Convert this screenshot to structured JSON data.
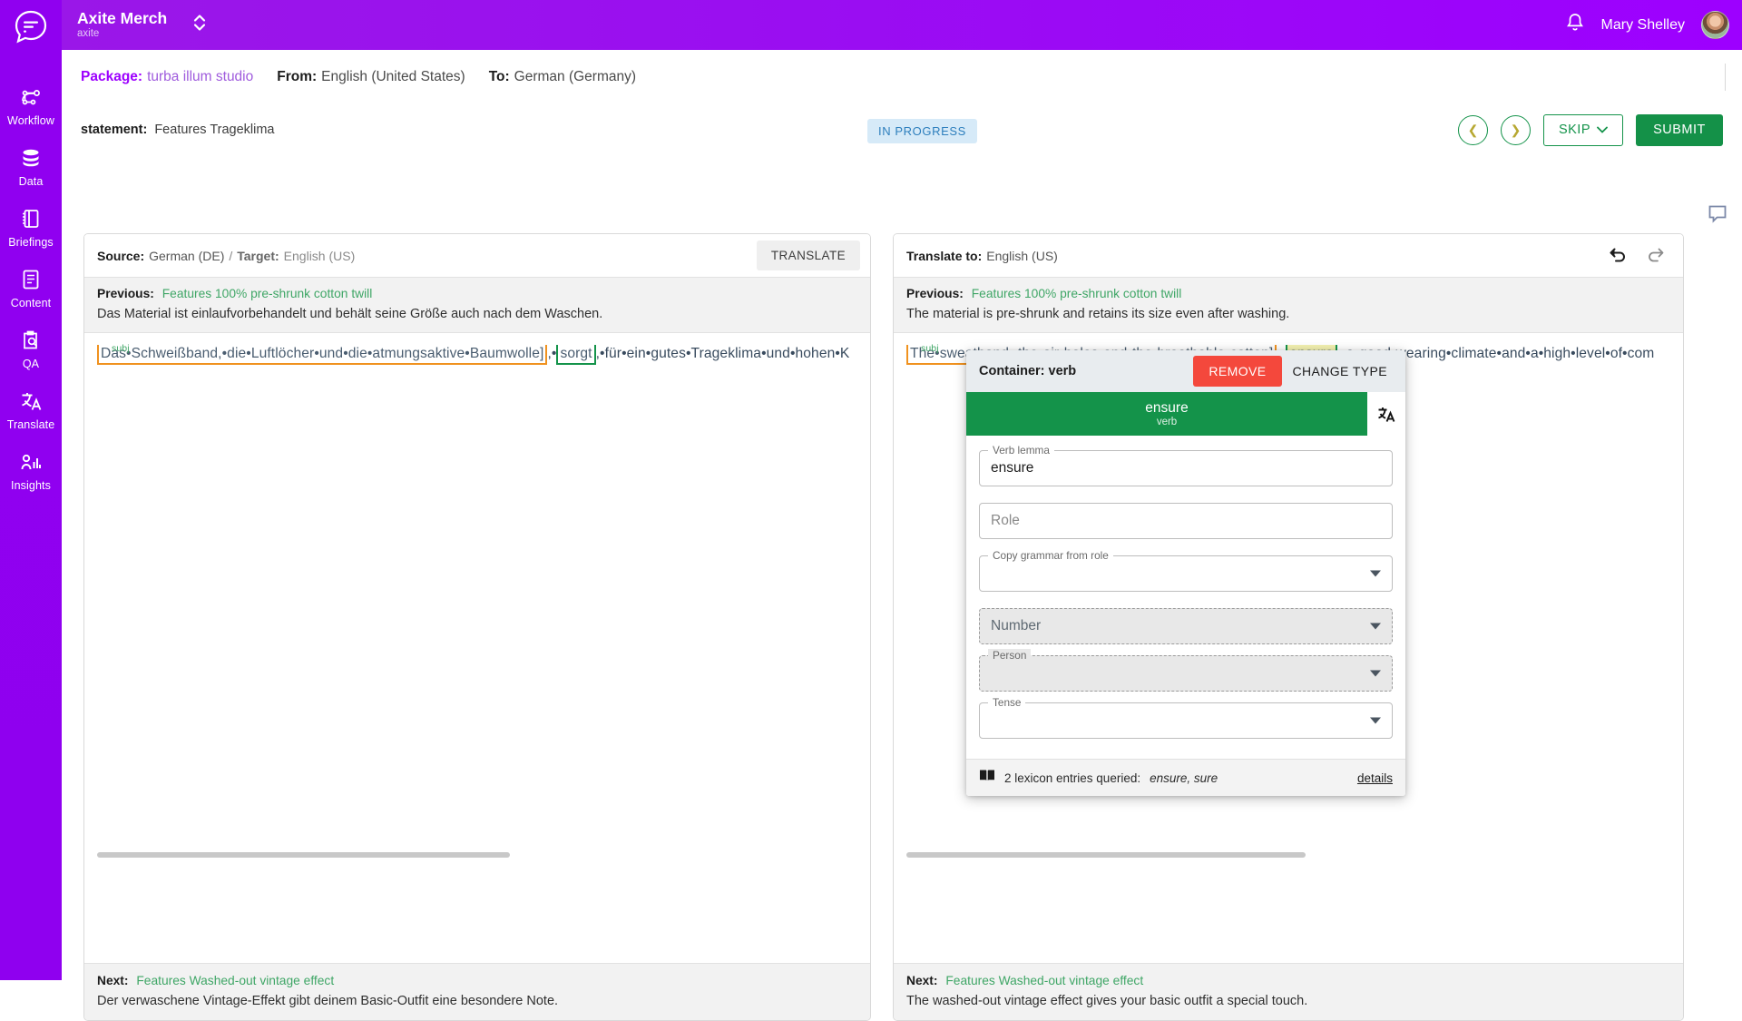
{
  "app": {
    "brand_title": "Axite Merch",
    "brand_sub": "axite",
    "logo_icon": "chat-bubble-lines-icon",
    "switcher_icon": "chevron-up-down-icon",
    "notification_icon": "bell-icon",
    "user_name": "Mary Shelley",
    "avatar_icon": "user-avatar",
    "accent_purple": "#9d00ff",
    "accent_green": "#14934a",
    "accent_red": "#f4483c",
    "accent_orange": "#f0921f",
    "highlight_yellow": "#f2f0b0"
  },
  "sidebar": {
    "items": [
      {
        "label": "Workflow",
        "icon": "workflow-icon"
      },
      {
        "label": "Data",
        "icon": "database-icon"
      },
      {
        "label": "Briefings",
        "icon": "notebook-icon"
      },
      {
        "label": "Content",
        "icon": "document-icon"
      },
      {
        "label": "QA",
        "icon": "clipboard-search-icon"
      },
      {
        "label": "Translate",
        "icon": "translate-icon"
      },
      {
        "label": "Insights",
        "icon": "chart-icon"
      }
    ]
  },
  "package_bar": {
    "package_label": "Package:",
    "package_value": "turba illum studio",
    "from_label": "From:",
    "from_value": "English (United States)",
    "to_label": "To:",
    "to_value": "German (Germany)"
  },
  "statement_row": {
    "label": "statement:",
    "value": "Features Trageklima",
    "status": "IN PROGRESS",
    "prev_icon": "chevron-left-icon",
    "next_icon": "chevron-right-icon",
    "skip_label": "SKIP",
    "skip_caret_icon": "chevron-down-icon",
    "submit_label": "SUBMIT"
  },
  "left_panel": {
    "source_label": "Source:",
    "source_value": "German (DE)",
    "separator": "/",
    "target_label": "Target:",
    "target_value": "English (US)",
    "translate_label": "TRANSLATE",
    "previous_label": "Previous:",
    "previous_title": "Features 100% pre-shrunk cotton twill",
    "previous_text": "Das Material ist einlaufvorbehandelt und behält seine Größe auch nach dem Waschen.",
    "annotation": {
      "subj_tag": "subj",
      "subj_text": "Das•Schweißband,•die•Luftlöcher•und•die•atmungsaktive•Baumwolle]",
      "mid_text": ",•",
      "verb_text": "sorgt",
      "tail_text": ",•für•ein•gutes•Trageklima•und•hohen•K"
    },
    "next_label": "Next:",
    "next_title": "Features Washed-out vintage effect",
    "next_text": "Der verwaschene Vintage-Effekt gibt deinem Basic-Outfit eine besondere Note."
  },
  "right_panel": {
    "translate_to_label": "Translate to:",
    "translate_to_value": "English (US)",
    "undo_icon": "undo-icon",
    "redo_icon": "redo-icon",
    "previous_label": "Previous:",
    "previous_title": "Features 100% pre-shrunk cotton twill",
    "previous_text": "The material is pre-shrunk and retains its size even after washing.",
    "annotation": {
      "subj_tag": "subj",
      "subj_text": "The•sweatband,•the•air•holes•and•the•breathable•cotton]",
      "mid_text": ",•",
      "verb_text": "ensure",
      "tail_text": ",•a•good•wearing•climate•and•a•high•level•of•com"
    },
    "next_label": "Next:",
    "next_title": "Features Washed-out vintage effect",
    "next_text": "The washed-out vintage effect gives your basic outfit a special touch."
  },
  "comment_rail": {
    "icon": "comment-icon"
  },
  "popover": {
    "title": "Container: verb",
    "remove_label": "REMOVE",
    "change_type_label": "CHANGE TYPE",
    "chip_word": "ensure",
    "chip_pos": "verb",
    "chip_action_icon": "translate-swap-icon",
    "fields": [
      {
        "name": "verb-lemma",
        "legend": "Verb lemma",
        "value": "ensure",
        "placeholder": "",
        "type": "text",
        "disabled": false
      },
      {
        "name": "role",
        "legend": "",
        "value": "",
        "placeholder": "Role",
        "type": "text",
        "disabled": false
      },
      {
        "name": "copy-grammar",
        "legend": "Copy grammar from role",
        "value": "",
        "placeholder": "",
        "type": "select",
        "disabled": false
      },
      {
        "name": "number",
        "legend": "",
        "value": "",
        "placeholder": "Number",
        "type": "select",
        "disabled": true
      },
      {
        "name": "person",
        "legend": "Person",
        "value": "",
        "placeholder": "",
        "type": "select",
        "disabled": true
      },
      {
        "name": "tense",
        "legend": "Tense",
        "value": "",
        "placeholder": "",
        "type": "select",
        "disabled": false
      }
    ],
    "footer": {
      "book_icon": "book-icon",
      "lexicon_text": "2 lexicon entries queried:",
      "lexicon_words": "ensure, sure",
      "details_label": "details"
    }
  }
}
